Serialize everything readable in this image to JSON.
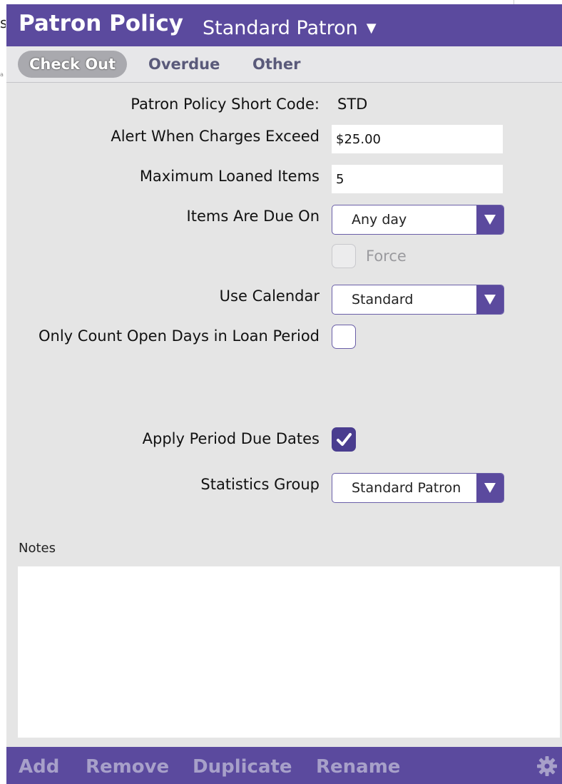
{
  "edge": {
    "left_fragment": "s",
    "left_small": "a"
  },
  "header": {
    "title": "Patron Policy",
    "policy_select": {
      "value": "Standard Patron",
      "caret": "▼"
    }
  },
  "tabs": [
    {
      "label": "Check Out",
      "active": true
    },
    {
      "label": "Overdue",
      "active": false
    },
    {
      "label": "Other",
      "active": false
    }
  ],
  "form": {
    "short_code": {
      "label": "Patron Policy Short Code:",
      "value": "STD"
    },
    "alert_charges": {
      "label": "Alert When Charges Exceed",
      "value": "$25.00"
    },
    "max_loaned": {
      "label": "Maximum Loaned Items",
      "value": "5"
    },
    "due_on": {
      "label": "Items Are Due On",
      "value": "Any day"
    },
    "force": {
      "label": "Force",
      "checked": false,
      "disabled": true
    },
    "calendar": {
      "label": "Use Calendar",
      "value": "Standard"
    },
    "open_days": {
      "label": "Only Count Open Days in Loan Period",
      "checked": false
    },
    "period_due": {
      "label": "Apply Period Due Dates",
      "checked": true
    },
    "stats_group": {
      "label": "Statistics Group",
      "value": "Standard Patron"
    }
  },
  "notes": {
    "label": "Notes",
    "value": ""
  },
  "footer": {
    "add": "Add",
    "remove": "Remove",
    "duplicate": "Duplicate",
    "rename": "Rename",
    "settings_icon": "gear-icon"
  },
  "colors": {
    "accent": "#5b4a9e",
    "panel_bg": "#e5e5e5",
    "footer_text": "#a7a0c9"
  }
}
